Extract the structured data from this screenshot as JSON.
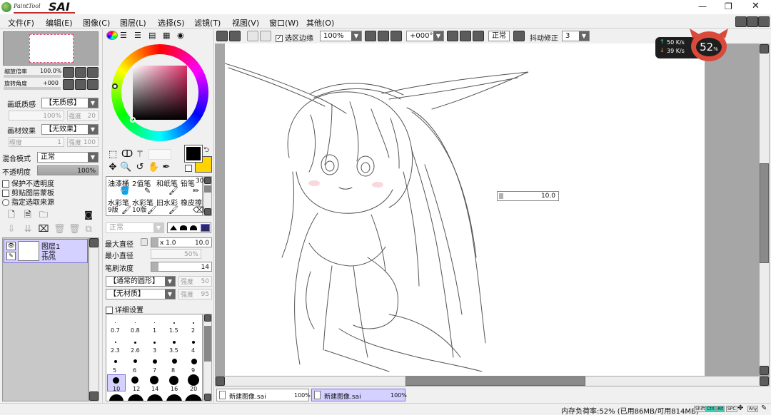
{
  "app": {
    "logo_sub": "PaintTool",
    "logo_main": "SAI"
  },
  "window_controls": {
    "minimize": "—",
    "restore": "❐",
    "close": "✕"
  },
  "menu": [
    "文件(F)",
    "编辑(E)",
    "图像(C)",
    "图层(L)",
    "选择(S)",
    "滤镜(T)",
    "视图(V)",
    "窗口(W)",
    "其他(O)"
  ],
  "navigator": {
    "zoom_label": "缩放倍率",
    "zoom_value": "100.0%",
    "rotate_label": "旋转角度",
    "rotate_value": "+000"
  },
  "paper": {
    "texture_label": "画纸质感",
    "texture_value": "【无质感】",
    "scale_label": "倍率",
    "scale_value": "100%",
    "strength_label": "强度",
    "strength_value": "20",
    "effect_label": "画材效果",
    "effect_value": "【无效果】",
    "degree_label": "程度",
    "degree_value": "1",
    "effect_strength_label": "强度",
    "effect_strength_value": "100"
  },
  "layer_props": {
    "blend_label": "混合模式",
    "blend_value": "正常",
    "opacity_label": "不透明度",
    "opacity_value": "100%",
    "protect_label": "保护不透明度",
    "clip_label": "剪贴图层蒙板",
    "source_label": "指定选取来源"
  },
  "layer": {
    "name": "图层1",
    "mode": "正常",
    "opacity": "100%"
  },
  "brushes": [
    {
      "name": "油漆桶",
      "size": ""
    },
    {
      "name": "2值笔",
      "size": ""
    },
    {
      "name": "和纸笔",
      "size": ""
    },
    {
      "name": "铅笔",
      "size": "30"
    },
    {
      "name": "水彩笔",
      "size": "9版"
    },
    {
      "name": "水彩笔",
      "size": "10版"
    },
    {
      "name": "旧水彩",
      "size": ""
    },
    {
      "name": "橡皮擦",
      "size": ""
    }
  ],
  "brush_settings": {
    "mode_value": "正常",
    "max_size_label": "最大直径",
    "max_size_mult": "x 1.0",
    "max_size_value": "10.0",
    "min_size_label": "最小直径",
    "min_size_value": "50%",
    "density_label": "笔刷浓度",
    "density_value": "14",
    "shape_value": "【通常的圆形】",
    "shape_strength_label": "强度",
    "shape_strength_value": "50",
    "texture_value": "【无材质】",
    "texture_strength_label": "强度",
    "texture_strength_value": "95",
    "detail_label": "详细设置"
  },
  "brush_sizes": [
    "0.7",
    "0.8",
    "1",
    "1.5",
    "2",
    "2.3",
    "2.6",
    "3",
    "3.5",
    "4",
    "5",
    "6",
    "7",
    "8",
    "9",
    "10",
    "12",
    "14",
    "16",
    "20"
  ],
  "toolbar": {
    "selection_edge_label": "选区边缘",
    "zoom_value": "100%",
    "angle_value": "+000°",
    "blend_value": "正常",
    "stabilizer_label": "抖动修正",
    "stabilizer_value": "3"
  },
  "net_widget": {
    "up": "50 K/s",
    "down": "39 K/s",
    "percent": "52",
    "unit": "%"
  },
  "canvas": {
    "size_tooltip": "10.0"
  },
  "tabs": [
    {
      "name": "新建图像.sai",
      "zoom": "100%"
    },
    {
      "name": "新建图像.sai",
      "zoom": "100%"
    }
  ],
  "status": {
    "memory": "内存负荷率:52% (已用86MB/可用814MB)",
    "keys": [
      "Shift",
      "Ctrl",
      "Alt",
      "SPC",
      "Any"
    ]
  },
  "colors": {
    "primary": "#000000",
    "secondary": "#ffd400",
    "accent_green": "#3fd1b5",
    "widget_red": "#d94a3a"
  }
}
